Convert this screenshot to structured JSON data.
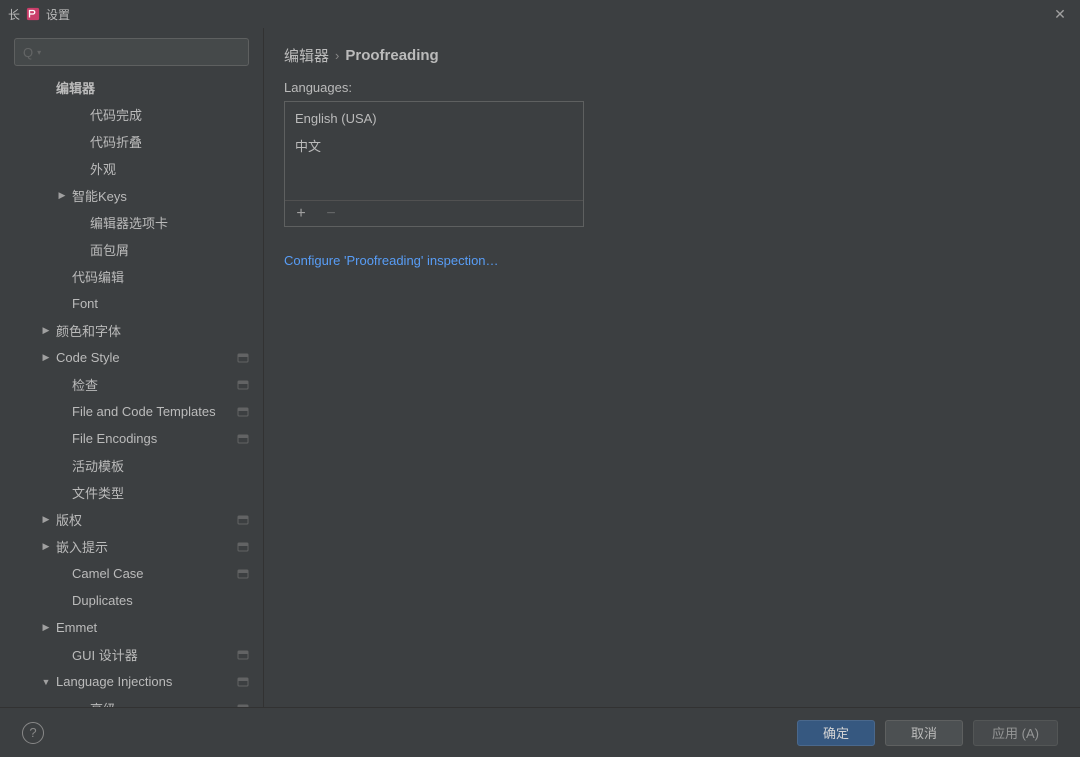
{
  "titlebar": {
    "left_char": "长",
    "title": "设置"
  },
  "search": {
    "placeholder": ""
  },
  "nav": {
    "editor_header": "编辑器",
    "code_completion": "代码完成",
    "code_folding": "代码折叠",
    "appearance": "外观",
    "smart_keys": "智能Keys",
    "editor_tabs": "编辑器选项卡",
    "breadcrumbs": "面包屑",
    "code_editing": "代码编辑",
    "font": "Font",
    "colors_fonts": "颜色和字体",
    "code_style": "Code Style",
    "inspections": "检查",
    "file_code_templates": "File and Code Templates",
    "file_encodings": "File Encodings",
    "live_templates": "活动模板",
    "file_types": "文件类型",
    "copyright": "版权",
    "inlay_hints": "嵌入提示",
    "camel_case": "Camel Case",
    "duplicates": "Duplicates",
    "emmet": "Emmet",
    "gui_designer": "GUI 设计器",
    "language_injections": "Language Injections",
    "advanced": "高级"
  },
  "content": {
    "breadcrumb_parent": "编辑器",
    "breadcrumb_sep": "›",
    "breadcrumb_current": "Proofreading",
    "languages_label": "Languages:",
    "language_items": {
      "0": "English (USA)",
      "1": "中文"
    },
    "configure_link": "Configure 'Proofreading' inspection…"
  },
  "footer": {
    "ok": "确定",
    "cancel": "取消",
    "apply": "应用 (A)"
  }
}
